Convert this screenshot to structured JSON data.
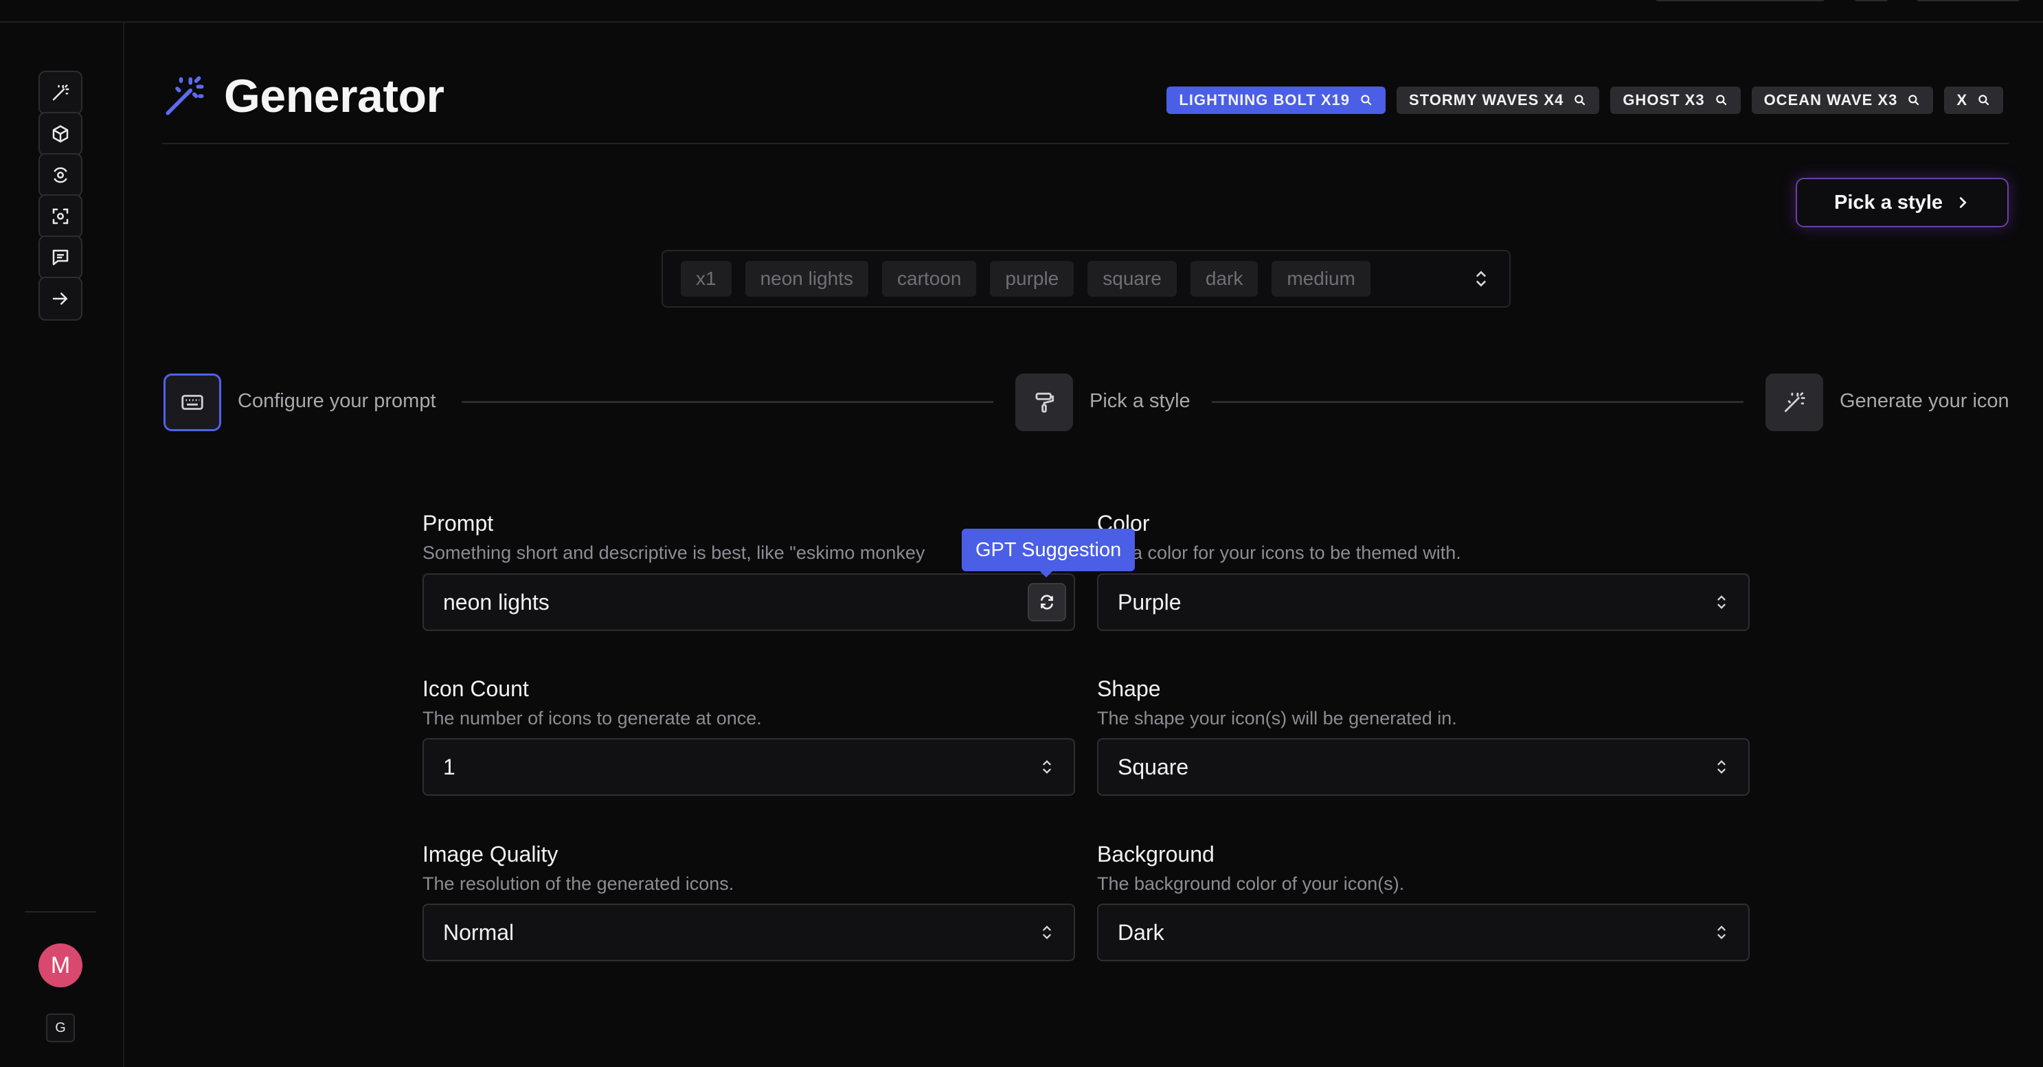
{
  "header": {
    "title": "Generator",
    "tags": [
      {
        "label": "LIGHTNING BOLT X19",
        "active": true
      },
      {
        "label": "STORMY WAVES X4",
        "active": false
      },
      {
        "label": "GHOST X3",
        "active": false
      },
      {
        "label": "OCEAN WAVE X3",
        "active": false
      },
      {
        "label": "X",
        "active": false
      }
    ]
  },
  "sidebar": {
    "items": [
      {
        "icon": "magic-wand-icon"
      },
      {
        "icon": "cube-icon"
      },
      {
        "icon": "target-icon"
      },
      {
        "icon": "focus-icon"
      },
      {
        "icon": "message-icon"
      },
      {
        "icon": "arrow-right-icon"
      }
    ],
    "avatar_initial": "M",
    "bottom_label": "G"
  },
  "pick_style_button": "Pick a style",
  "prompt_chips": [
    "x1",
    "neon lights",
    "cartoon",
    "purple",
    "square",
    "dark",
    "medium"
  ],
  "steps": [
    {
      "label": "Configure your prompt",
      "icon": "keyboard-icon"
    },
    {
      "label": "Pick a style",
      "icon": "paint-roller-icon"
    },
    {
      "label": "Generate your icon",
      "icon": "magic-wand-icon"
    }
  ],
  "form": {
    "prompt": {
      "label": "Prompt",
      "description": "Something short and descriptive is best, like \"eskimo monkey",
      "value": "neon lights",
      "tooltip": "GPT Suggestion"
    },
    "color": {
      "label": "Color",
      "description": "ose a color for your icons to be themed with.",
      "value": "Purple"
    },
    "icon_count": {
      "label": "Icon Count",
      "description": "The number of icons to generate at once.",
      "value": "1"
    },
    "shape": {
      "label": "Shape",
      "description": "The shape your icon(s) will be generated in.",
      "value": "Square"
    },
    "image_quality": {
      "label": "Image Quality",
      "description": "The resolution of the generated icons.",
      "value": "Normal"
    },
    "background": {
      "label": "Background",
      "description": "The background color of your icon(s).",
      "value": "Dark"
    }
  },
  "colors": {
    "accent": "#4a5ee6",
    "background": "#0a0a0b",
    "avatar": "#d9486f"
  }
}
